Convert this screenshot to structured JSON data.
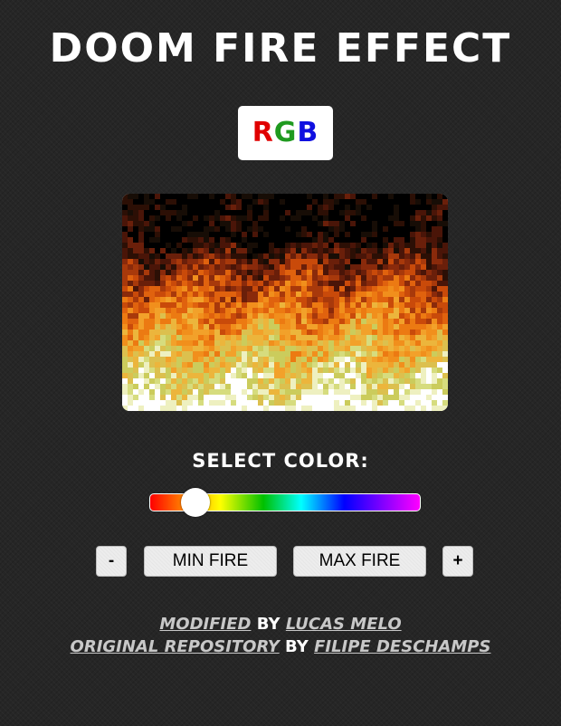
{
  "header": {
    "title": "DOOM FIRE EFFECT"
  },
  "rgb_toggle": {
    "letters": [
      {
        "char": "R",
        "color": "#e00000"
      },
      {
        "char": "G",
        "color": "#1f9a1f"
      },
      {
        "char": "B",
        "color": "#1010e0"
      }
    ]
  },
  "fire_canvas": {
    "palette": [
      "#000000",
      "#170d06",
      "#2c0f05",
      "#4a1508",
      "#6a1f0a",
      "#8a2a0b",
      "#a8390b",
      "#c94a0a",
      "#e0620e",
      "#ec7a12",
      "#f18f1c",
      "#f2a12a",
      "#ecb53c",
      "#dcc04e",
      "#cbcc5c",
      "#d6dc7e",
      "#eef0c0",
      "#ffffff"
    ]
  },
  "color_selector": {
    "label": "SELECT COLOR:",
    "value_fraction": 0.17
  },
  "controls": {
    "decrease_label": "-",
    "min_fire_label": "MIN FIRE",
    "max_fire_label": "MAX FIRE",
    "increase_label": "+"
  },
  "credits": {
    "line1": {
      "link1": "MODIFIED",
      "by": "BY",
      "link2": "LUCAS MELO"
    },
    "line2": {
      "link1": "ORIGINAL REPOSITORY",
      "by": "BY",
      "link2": "FILIPE DESCHAMPS"
    }
  }
}
